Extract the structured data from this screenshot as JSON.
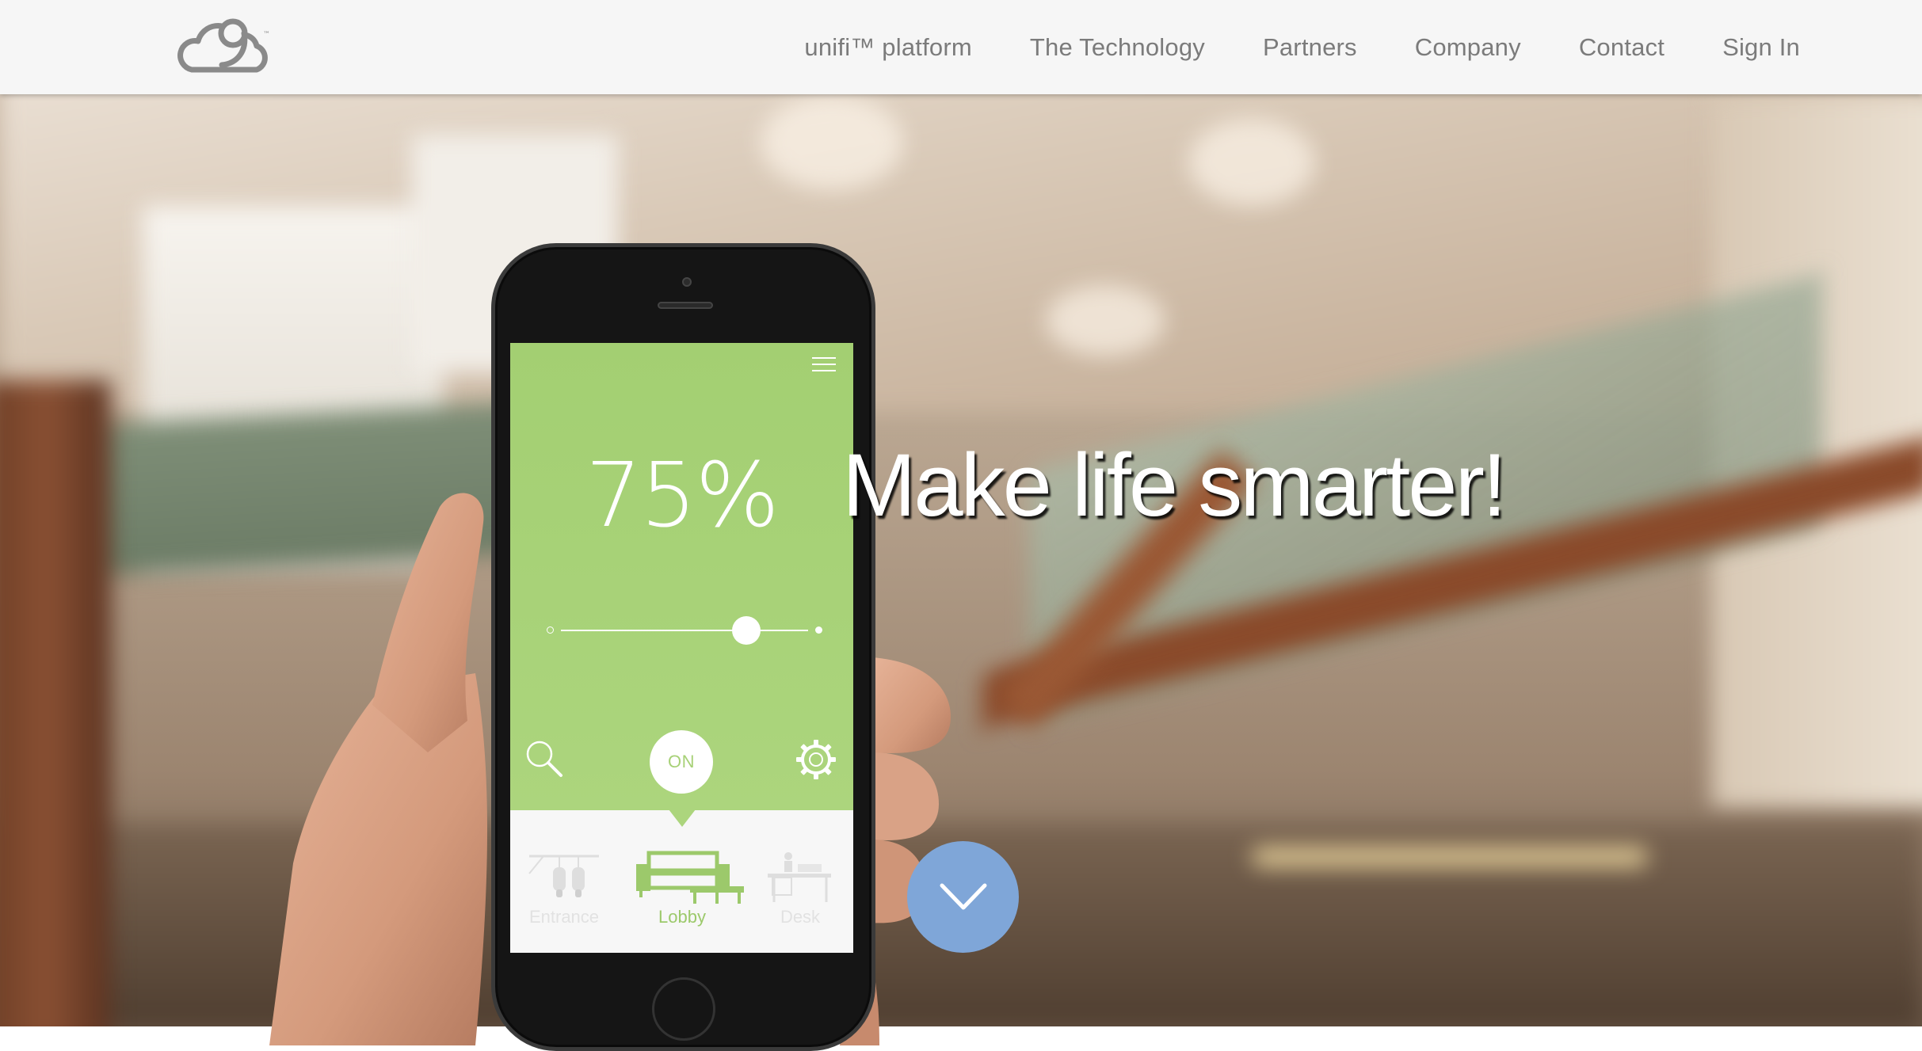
{
  "nav": {
    "items": [
      {
        "label": "unifi™ platform"
      },
      {
        "label": "The Technology"
      },
      {
        "label": "Partners"
      },
      {
        "label": "Company"
      },
      {
        "label": "Contact"
      },
      {
        "label": "Sign In"
      }
    ]
  },
  "logo": {
    "icon": "cloud-9-logo-icon",
    "mark": "™"
  },
  "hero": {
    "headline": "Make life smarter!",
    "scroll_icon": "chevron-down-icon",
    "scroll_color": "#7fa6d8"
  },
  "app": {
    "accent_color": "#a7d177",
    "brightness_label": "75%",
    "brightness_value": 0.75,
    "power_label": "ON",
    "rooms": [
      {
        "label": "Entrance",
        "icon": "track-lights-icon",
        "selected": false
      },
      {
        "label": "Lobby",
        "icon": "sofa-icon",
        "selected": true
      },
      {
        "label": "Desk",
        "icon": "desk-icon",
        "selected": false
      }
    ]
  }
}
